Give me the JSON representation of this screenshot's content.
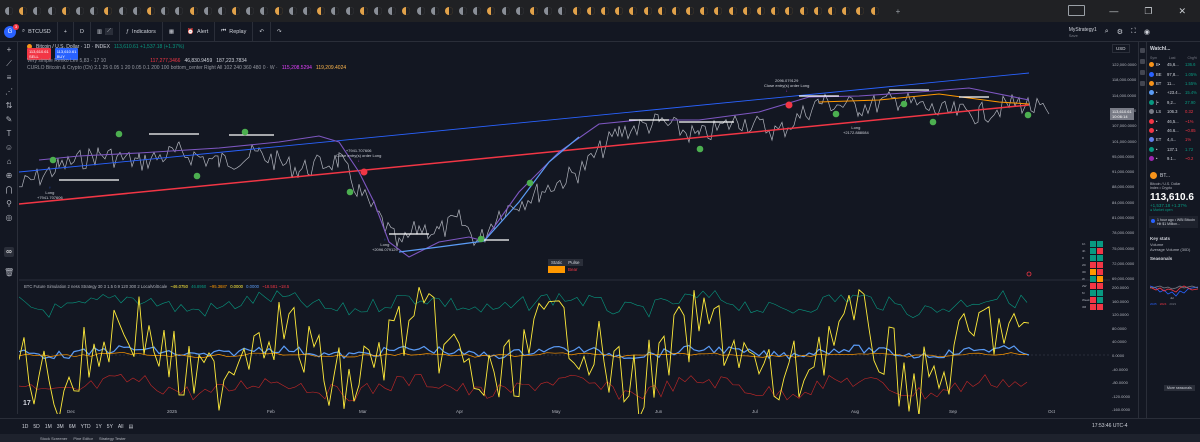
{
  "window": {
    "tabs_count": 62,
    "new_tab": "+",
    "controls": [
      "—",
      "❐",
      "✕"
    ]
  },
  "toolbar": {
    "symbol": "BTCUSD",
    "add": "+",
    "interval": "D",
    "indicators": "Indicators",
    "alert": "Alert",
    "replay": "Replay",
    "layout_name": "MyStrategy1",
    "save_state": "Save",
    "publish": "Publish"
  },
  "legend": {
    "title": "Bitcoin / U.S. Dollar · 1D · INDEX",
    "ohlc_label": "113,610.61 +1,537.18 (+1.37%)",
    "sell_price": "113,610.61",
    "sell_label": "SELL",
    "buy_price": "113,610.61",
    "buy_label": "BUY",
    "ind1_name": "Very simple Renko Lev 5,83 · 17 10",
    "ind1_v1": "117,277,3466",
    "ind1_v2": "46,830.9459",
    "ind1_v3": "187,223.7834",
    "ind2_name": "CURLO Bitcoin & Crypto (Ch) 2.1 25 0.05 1 20 0.05 0.1 200 100 bottom_center Right All 102 240 360 480 0 · W ·",
    "ind2_v1": "115,208.5294",
    "ind2_v2": "119,209.4024"
  },
  "annotations": {
    "a1_price": "+7941.707606",
    "a1_text": "Long",
    "a2_price": "+7941.707606",
    "a2_text": "Close entry(s) order Long",
    "a3_text": "Long",
    "a3_price": "+2096.079129",
    "a4_price": "2096.079129",
    "a4_text": "Close entry(s) order Long",
    "a5_text": "Long",
    "a5_price": "+2172.888084"
  },
  "status_table": {
    "col1": "Static",
    "col2": "Pulse",
    "val1": "Bull",
    "val2": "Bear"
  },
  "signal_grid": {
    "rows": [
      "1h",
      "4h",
      "D",
      "2D",
      "3D",
      "W",
      "2W",
      "M",
      "Week",
      "3M"
    ]
  },
  "oscillator": {
    "name": "BTC Future Simulation 2 ness Strategy 30 3 1.5 0.9 120 300 2 LocalVolScale",
    "v1": "~46.0750",
    "v2": "46.8950",
    "v3": "~95.3687",
    "v4": "0.0000",
    "v5": "0.0000",
    "v6": "~18.581 ~18.5"
  },
  "price_axis": {
    "currency": "USD",
    "labels": [
      "122,000.0000",
      "118,000.0000",
      "114,000.0000",
      "110,000.0000",
      "107,000.0000",
      "101,000.0000",
      "95,000.0000",
      "91,000.0000",
      "88,000.0000",
      "84,000.0000",
      "81,000.0000",
      "78,000.0000",
      "75,000.0000",
      "72,000.0000",
      "69,000.0000"
    ],
    "current": "113,610.61",
    "current_time": "10:06:14"
  },
  "osc_axis": {
    "labels": [
      "200.0000",
      "160.0000",
      "120.0000",
      "80.0000",
      "40.0000",
      "0.0000",
      "-40.0000",
      "-80.0000",
      "-120.0000",
      "-160.0000"
    ]
  },
  "time_axis": [
    "Dec",
    "2025",
    "Feb",
    "Mar",
    "Apr",
    "May",
    "Jun",
    "Jul",
    "Aug",
    "Sep",
    "Oct"
  ],
  "bottombar": {
    "ranges": [
      "1D",
      "5D",
      "1M",
      "3M",
      "6M",
      "YTD",
      "1Y",
      "5Y",
      "All"
    ],
    "clock": "17:53:46 UTC-4",
    "tabs": [
      "Stock Screener",
      "Pine Editor",
      "Strategy Tester"
    ]
  },
  "watchlist": {
    "title": "Watchl...",
    "cols": [
      "Sym",
      "Last",
      "Chg%"
    ],
    "rows": [
      {
        "sym": "B•",
        "last": "45,6...",
        "chg": "136.6",
        "color": "#f7931a",
        "neg": false
      },
      {
        "sym": "BE",
        "last": "97,8...",
        "chg": "1.05%",
        "color": "#2962ff",
        "neg": false
      },
      {
        "sym": "BT",
        "last": "11...",
        "chg": "1.55%",
        "color": "#f7931a",
        "neg": false
      },
      {
        "sym": "•",
        "last": "+23.4...",
        "chg": "15.4%",
        "color": "#5b9cf6",
        "neg": false
      },
      {
        "sym": "[•",
        "last": "9,2...",
        "chg": "27.90",
        "color": "#089981",
        "neg": false
      },
      {
        "sym": "LS",
        "last": "106.3",
        "chg": "0.32",
        "color": "#787b86",
        "neg": true
      },
      {
        "sym": "•",
        "last": "46,5...",
        "chg": "~1%",
        "color": "#f23645",
        "neg": true
      },
      {
        "sym": "•",
        "last": "46.6...",
        "chg": "~0.85",
        "color": "#f23645",
        "neg": true
      },
      {
        "sym": "ET",
        "last": "4,4...",
        "chg": "1%",
        "color": "#627eea",
        "neg": true
      },
      {
        "sym": "•",
        "last": "137.1",
        "chg": "1.72",
        "color": "#089981",
        "neg": false
      },
      {
        "sym": "•",
        "last": "9.1...",
        "chg": "~0.2",
        "color": "#9c27b0",
        "neg": true
      }
    ]
  },
  "details": {
    "symbol": "BT...",
    "description": "Bitcoin / U.S. Dollar",
    "exchange": "Index • Crypto",
    "price": "113,610.6",
    "change": "+1,537.18 +1.37%",
    "market": "● Market open",
    "news": "1 hour ago • WBI Bitcoin Hit $1 Million...",
    "key_stats": "Key stats",
    "volume": "Volume",
    "avg_volume": "Average Volume (30D)",
    "seasonals": "Seasonals",
    "seasonal_month": "Jul",
    "seasonal_legend": [
      "2025",
      "2024",
      "2023"
    ],
    "more_seasonals": "More seasonals"
  }
}
